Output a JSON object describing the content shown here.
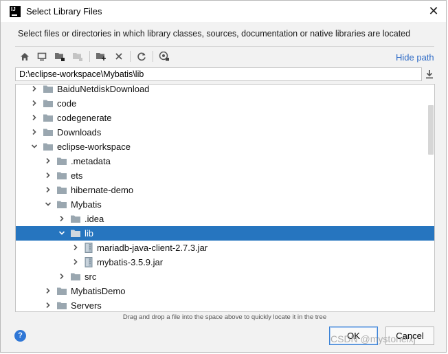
{
  "window": {
    "title": "Select Library Files",
    "close_glyph": "✕"
  },
  "description": "Select files or directories in which library classes, sources, documentation or native libraries are located",
  "toolbar": {
    "buttons": [
      {
        "name": "home-icon",
        "glyph": "⌂",
        "disabled": false
      },
      {
        "name": "desktop-icon",
        "glyph": "▭",
        "disabled": false
      },
      {
        "name": "project-icon",
        "glyph": "▆",
        "disabled": false
      },
      {
        "name": "module-icon",
        "glyph": "▆",
        "disabled": true
      },
      {
        "name": "new-folder-icon",
        "glyph": "▆",
        "disabled": false
      },
      {
        "name": "delete-icon",
        "glyph": "✕",
        "disabled": false
      },
      {
        "name": "refresh-icon",
        "glyph": "⟳",
        "disabled": false
      },
      {
        "name": "show-hidden-icon",
        "glyph": "◉",
        "disabled": false
      }
    ],
    "hide_path": "Hide path"
  },
  "path": "D:\\eclipse-workspace\\Mybatis\\lib",
  "tree": [
    {
      "label": "BaiduNetdiskDownload",
      "level": 0,
      "expanded": false,
      "kind": "folder",
      "selected": false
    },
    {
      "label": "code",
      "level": 0,
      "expanded": false,
      "kind": "folder",
      "selected": false
    },
    {
      "label": "codegenerate",
      "level": 0,
      "expanded": false,
      "kind": "folder",
      "selected": false
    },
    {
      "label": "Downloads",
      "level": 0,
      "expanded": false,
      "kind": "folder",
      "selected": false
    },
    {
      "label": "eclipse-workspace",
      "level": 0,
      "expanded": true,
      "kind": "folder",
      "selected": false
    },
    {
      "label": ".metadata",
      "level": 1,
      "expanded": false,
      "kind": "folder",
      "selected": false
    },
    {
      "label": "ets",
      "level": 1,
      "expanded": false,
      "kind": "folder",
      "selected": false
    },
    {
      "label": "hibernate-demo",
      "level": 1,
      "expanded": false,
      "kind": "folder",
      "selected": false
    },
    {
      "label": "Mybatis",
      "level": 1,
      "expanded": true,
      "kind": "folder",
      "selected": false
    },
    {
      "label": ".idea",
      "level": 2,
      "expanded": false,
      "kind": "folder",
      "selected": false
    },
    {
      "label": "lib",
      "level": 2,
      "expanded": true,
      "kind": "folder",
      "selected": true
    },
    {
      "label": "mariadb-java-client-2.7.3.jar",
      "level": 3,
      "expanded": false,
      "kind": "jar",
      "selected": false
    },
    {
      "label": "mybatis-3.5.9.jar",
      "level": 3,
      "expanded": false,
      "kind": "jar",
      "selected": false
    },
    {
      "label": "src",
      "level": 2,
      "expanded": false,
      "kind": "folder",
      "selected": false
    },
    {
      "label": "MybatisDemo",
      "level": 1,
      "expanded": false,
      "kind": "folder",
      "selected": false
    },
    {
      "label": "Servers",
      "level": 1,
      "expanded": false,
      "kind": "folder",
      "selected": false
    }
  ],
  "hint": "Drag and drop a file into the space above to quickly locate it in the tree",
  "buttons": {
    "help": "?",
    "ok": "OK",
    "cancel": "Cancel"
  },
  "watermark": "CSDN @mystonelxj",
  "colors": {
    "selection": "#2675bf",
    "link": "#2d6ac6",
    "folder": "#9aa7b0",
    "ok_border": "#3b82d6"
  }
}
